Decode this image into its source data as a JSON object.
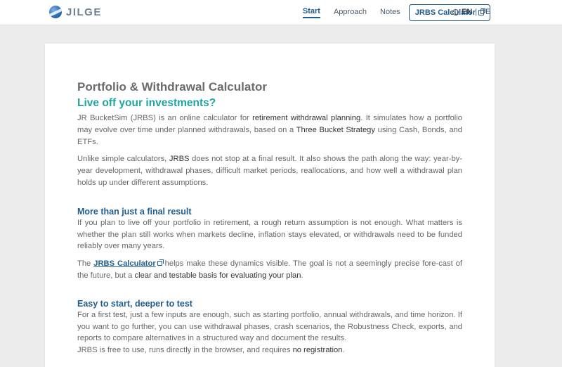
{
  "header": {
    "logo_text": "JILGE",
    "nav": {
      "start": "Start",
      "approach": "Approach",
      "notes": "Notes",
      "cta": "JRBS Calculator"
    },
    "lang": {
      "en": "EN",
      "sep": "|",
      "de": "DE"
    }
  },
  "main": {
    "title": "Portfolio & Withdrawal Calculator",
    "subtitle": "Live off your investments?",
    "intro": {
      "t1": "JR BucketSim (JRBS) is an online calculator for ",
      "b1": "retirement withdrawal planning",
      "t2": ". It simulates how a portfolio may evolve over time under planned withdrawals, based on a ",
      "b2": "Three Bucket Strategy",
      "t3": " using Cash, Bonds, and ETFs."
    },
    "para2": {
      "t1": "Unlike simple calculators, ",
      "b1": "JRBS",
      "t2": " does not stop at a final result. It also shows the path along the way: year-by-year development, withdrawal phases, difficult market periods, reallocations, and how well a withdrawal plan holds up under different assumptions."
    },
    "section1": {
      "heading": "More than just a final result",
      "p1": "If you plan to live off your portfolio in retirement, a rough return assumption is not enough. What matters is whether the plan still works when markets decline, inflation stays elevated, or withdrawals need to be funded reliably over many years.",
      "p2_t1": "The ",
      "p2_link": "JRBS Calculator",
      "p2_t2": " helps make these dynamics visible. The goal is not a seemingly precise fore-cast of the future, but a ",
      "p2_b": "clear and testable basis for evaluating your plan",
      "p2_t3": "."
    },
    "section2": {
      "heading": "Easy to start, deeper to test",
      "p1": "For a first test, just a few inputs are enough, such as starting portfolio, annual withdrawals, and time horizon. If you want to go further, you can use withdrawal phases, crash scenarios, the Robustness Check, exports, and reports to compare alternatives in a structured way and document the results.",
      "p2_t1": "JRBS is free to use, runs directly in the browser, and requires ",
      "p2_b": "no registration",
      "p2_t2": "."
    }
  },
  "colors": {
    "accent": "#1f5d8f",
    "subtitle": "#1fa5a0",
    "page_bg": "#ececec"
  }
}
